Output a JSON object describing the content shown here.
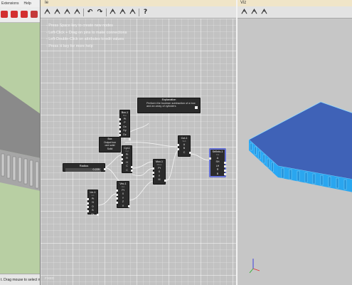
{
  "sketchup": {
    "menu": [
      "Extensions",
      "Help"
    ],
    "status_text": "t. Drag mouse to select n",
    "colors": {
      "ground": "#b8cfa3",
      "box": "#a6a6a6",
      "box_top": "#8a8a8a"
    },
    "tool_icons": [
      {
        "name": "move-icon",
        "color": "#d33030"
      },
      {
        "name": "rotate-icon",
        "color": "#d33030"
      },
      {
        "name": "scale-icon",
        "color": "#d33030"
      },
      {
        "name": "offset-icon",
        "color": "#c43a3a"
      }
    ]
  },
  "graph": {
    "title": "Ie",
    "toolbar": [
      {
        "name": "new-graph-icon",
        "glyph": "ᗅ"
      },
      {
        "name": "open-graph-icon",
        "glyph": "ᗅ"
      },
      {
        "name": "save-graph-icon",
        "glyph": "ᗅ"
      },
      {
        "name": "save-as-graph-icon",
        "glyph": "ᗅ"
      },
      {
        "name": "undo-icon",
        "glyph": "↶"
      },
      {
        "name": "redo-icon",
        "glyph": "↷"
      },
      {
        "name": "frame-icon",
        "glyph": "ᗅ"
      },
      {
        "name": "reset-view-icon",
        "glyph": "ᗅ"
      },
      {
        "name": "fit-view-icon",
        "glyph": "ᗅ"
      },
      {
        "name": "help-icon",
        "glyph": "?"
      }
    ],
    "help_lines": [
      "- Press Space key to create new nodes",
      "- Left-Click + Drag on pins to make connections",
      "- Left-Double-Click on attributes to edit values",
      "- Press H key for more help"
    ],
    "footer": "FIXED",
    "explanation": {
      "title": "Explanation",
      "text": "Perform the boolean subtraction of a box and an array of cylinders"
    },
    "radius": {
      "label": "Radius",
      "value": "0.225"
    },
    "box_output": {
      "lines": [
        "Box",
        "Output box",
        "one solid",
        "Solid"
      ]
    },
    "nodes": {
      "box": {
        "title": "Box-1",
        "sub": "Box",
        "pins": [
          "Pt",
          "P",
          "Dx",
          "Dy",
          "Dz",
          "B"
        ]
      },
      "cyl": {
        "title": "Cyl-1",
        "sub": "Cyl",
        "pins": [
          "Pt",
          "R",
          "H",
          "C",
          "C"
        ]
      },
      "mov": {
        "title": "Mov-1",
        "sub": "Move",
        "pins": [
          "Pt",
          "X",
          "Y",
          "M"
        ]
      },
      "sub": {
        "title": "Cut-1",
        "sub": "Sub",
        "pins": [
          "A",
          "B",
          "C"
        ]
      },
      "srf": {
        "title": "Srf/Info-1",
        "sub": "Out",
        "pins": [
          "A",
          "SH",
          "LH",
          "R",
          "B"
        ]
      },
      "lin": {
        "title": "Lin-1",
        "sub": "Lin",
        "pins": [
          "Pt",
          "N",
          "D",
          "B",
          "Ps"
        ]
      },
      "vec": {
        "title": "Vec-1",
        "sub": "Vec",
        "pins": [
          "Pt",
          "X",
          "Y",
          "Z",
          "V"
        ]
      }
    }
  },
  "viewer": {
    "title": "Viz",
    "toolbar": [
      {
        "name": "viz-view-icon",
        "glyph": "ᗅ"
      },
      {
        "name": "viz-camera-icon",
        "glyph": "ᗅ"
      },
      {
        "name": "viz-fit-icon",
        "glyph": "ᗅ"
      }
    ],
    "colors": {
      "top": "#3f62b7",
      "side": "#29a8f5",
      "edge": "#8fd9ff"
    },
    "axes": {
      "x": "#e03030",
      "y": "#30b030",
      "z": "#3030e0"
    }
  }
}
